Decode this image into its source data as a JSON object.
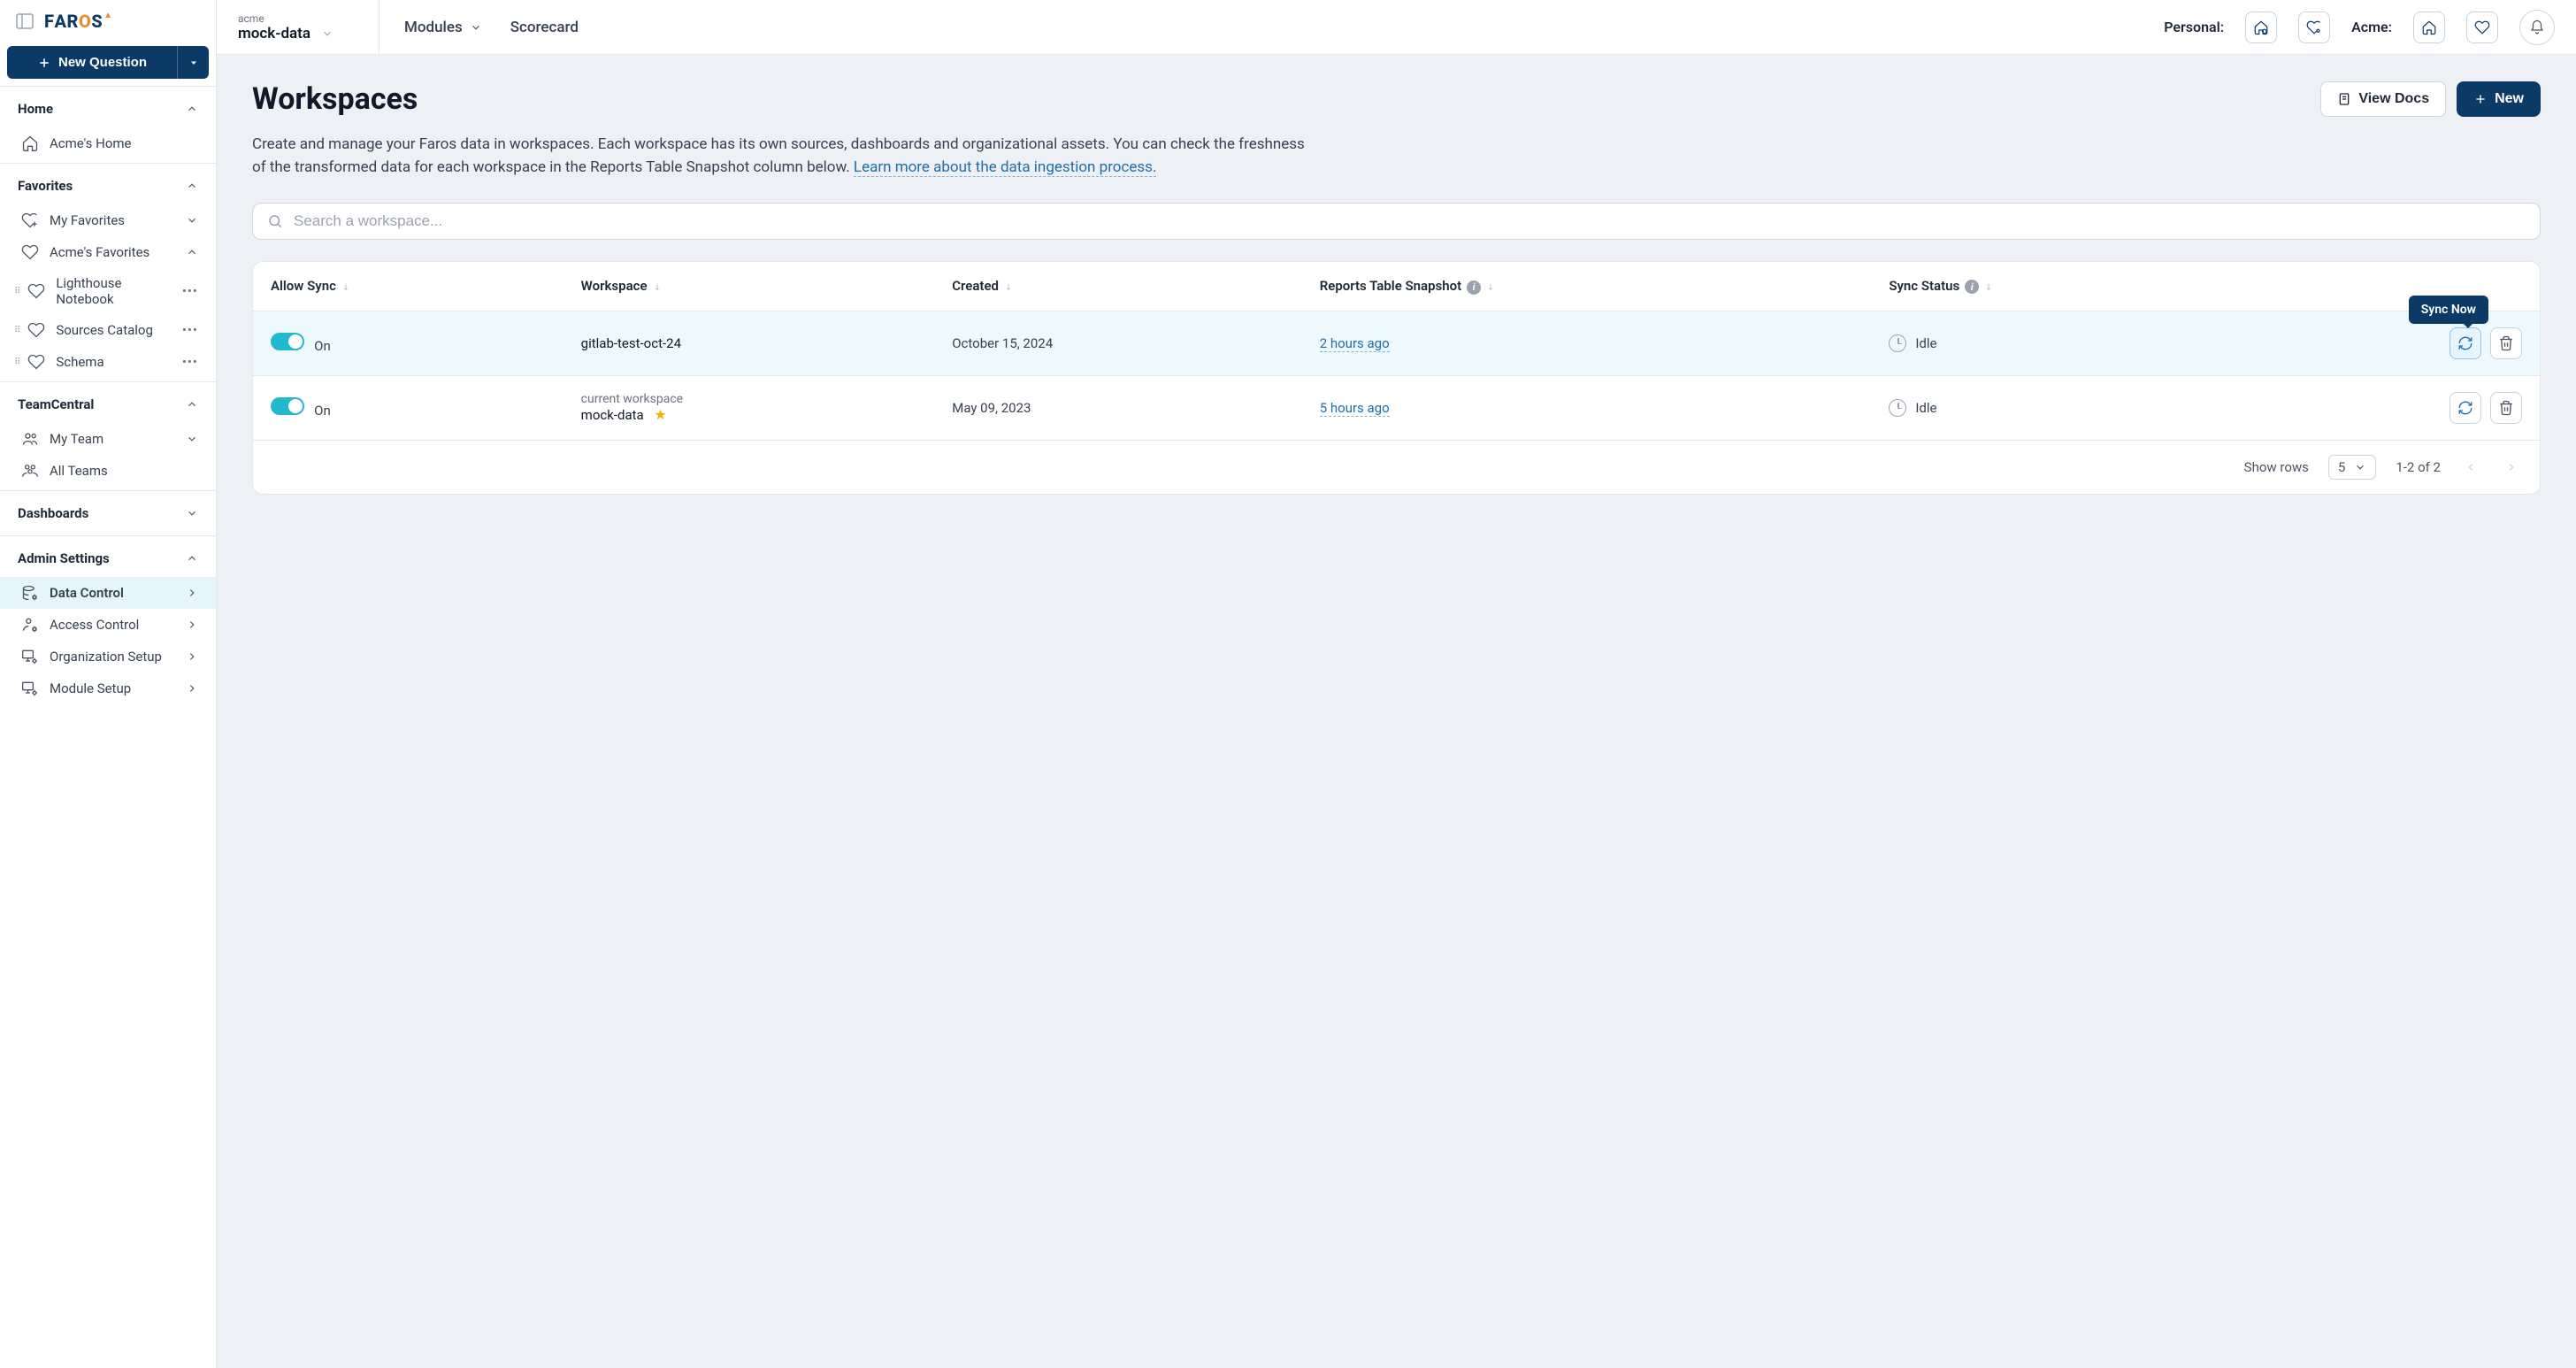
{
  "brand": "FAROS",
  "sidebar": {
    "new_question": "New Question",
    "sections": {
      "home": {
        "title": "Home",
        "items": [
          {
            "label": "Acme's Home"
          }
        ]
      },
      "favorites": {
        "title": "Favorites",
        "items": [
          {
            "label": "My Favorites"
          },
          {
            "label": "Acme's Favorites"
          },
          {
            "label": "Lighthouse Notebook"
          },
          {
            "label": "Sources Catalog"
          },
          {
            "label": "Schema"
          }
        ]
      },
      "teamcentral": {
        "title": "TeamCentral",
        "items": [
          {
            "label": "My Team"
          },
          {
            "label": "All Teams"
          }
        ]
      },
      "dashboards": {
        "title": "Dashboards"
      },
      "admin": {
        "title": "Admin Settings",
        "items": [
          {
            "label": "Data Control"
          },
          {
            "label": "Access Control"
          },
          {
            "label": "Organization Setup"
          },
          {
            "label": "Module Setup"
          }
        ]
      }
    }
  },
  "topbar": {
    "org": "acme",
    "workspace": "mock-data",
    "nav": {
      "modules": "Modules",
      "scorecard": "Scorecard"
    },
    "personal_label": "Personal:",
    "acme_label": "Acme:"
  },
  "page": {
    "title": "Workspaces",
    "view_docs": "View Docs",
    "new": "New",
    "description": "Create and manage your Faros data in workspaces. Each workspace has its own sources, dashboards and organizational assets. You can check the freshness of the transformed data for each workspace in the Reports Table Snapshot column below. ",
    "learn_more": "Learn more about the data ingestion process.",
    "search_placeholder": "Search a workspace..."
  },
  "table": {
    "headers": {
      "allow_sync": "Allow Sync",
      "workspace": "Workspace",
      "created": "Created",
      "reports": "Reports Table Snapshot",
      "sync_status": "Sync Status"
    },
    "rows": [
      {
        "allow_sync": "On",
        "workspace_name": "gitlab-test-oct-24",
        "is_current": false,
        "created": "October 15, 2024",
        "snapshot": "2 hours ago",
        "status": "Idle"
      },
      {
        "allow_sync": "On",
        "workspace_sup": "current workspace",
        "workspace_name": "mock-data",
        "is_current": true,
        "created": "May 09, 2023",
        "snapshot": "5 hours ago",
        "status": "Idle"
      }
    ],
    "tooltip_sync_now": "Sync Now"
  },
  "pager": {
    "show_rows": "Show rows",
    "page_size": "5",
    "range": "1-2 of 2"
  }
}
